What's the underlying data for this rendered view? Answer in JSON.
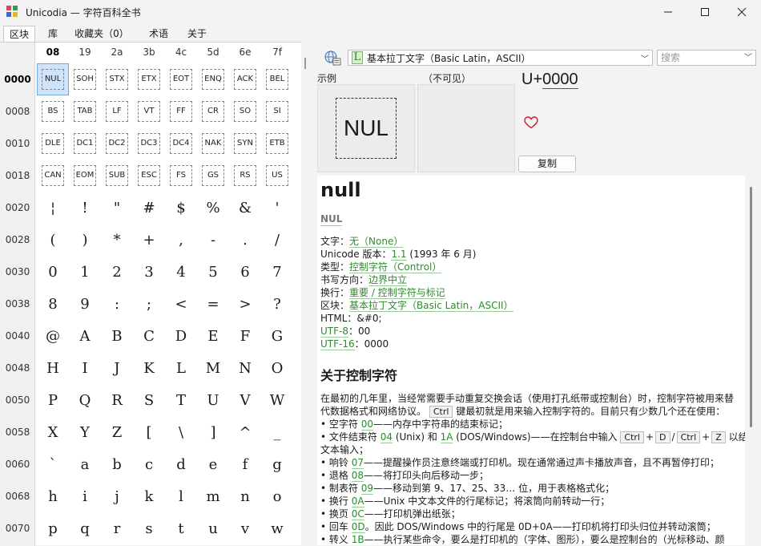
{
  "window": {
    "title": "Unicodia — 字符百科全书",
    "icon": "unicodia-app-icon",
    "controls": [
      "minimize-icon",
      "maximize-icon",
      "close-icon"
    ]
  },
  "tabs": [
    {
      "label": "区块",
      "active": true
    },
    {
      "label": "库",
      "active": false
    },
    {
      "label": "收藏夹（0）",
      "active": false
    },
    {
      "label": "术语",
      "active": false
    },
    {
      "label": "关于",
      "active": false
    }
  ],
  "grid": {
    "col_headers": [
      "08",
      "19",
      "2a",
      "3b",
      "4c",
      "5d",
      "6e",
      "7f"
    ],
    "selected_col": "08",
    "selected_row": "0000",
    "selected_cell": "NUL",
    "rows": [
      {
        "label": "0000",
        "cells": [
          "NUL",
          "SOH",
          "STX",
          "ETX",
          "EOT",
          "ENQ",
          "ACK",
          "BEL"
        ],
        "ctrl": true
      },
      {
        "label": "0008",
        "cells": [
          "BS",
          "TAB",
          "LF",
          "VT",
          "FF",
          "CR",
          "SO",
          "SI"
        ],
        "ctrl": true
      },
      {
        "label": "0010",
        "cells": [
          "DLE",
          "DC1",
          "DC2",
          "DC3",
          "DC4",
          "NAK",
          "SYN",
          "ETB"
        ],
        "ctrl": true
      },
      {
        "label": "0018",
        "cells": [
          "CAN",
          "EOM",
          "SUB",
          "ESC",
          "FS",
          "GS",
          "RS",
          "US"
        ],
        "ctrl": true
      },
      {
        "label": "0020",
        "cells": [
          "¦",
          "!",
          "\"",
          "#",
          "$",
          "%",
          "&",
          "'"
        ],
        "ctrl": false
      },
      {
        "label": "0028",
        "cells": [
          "(",
          ")",
          "*",
          "+",
          ",",
          "-",
          ".",
          "/"
        ],
        "ctrl": false
      },
      {
        "label": "0030",
        "cells": [
          "0",
          "1",
          "2",
          "3",
          "4",
          "5",
          "6",
          "7"
        ],
        "ctrl": false
      },
      {
        "label": "0038",
        "cells": [
          "8",
          "9",
          ":",
          ";",
          "<",
          "=",
          ">",
          "?"
        ],
        "ctrl": false
      },
      {
        "label": "0040",
        "cells": [
          "@",
          "A",
          "B",
          "C",
          "D",
          "E",
          "F",
          "G"
        ],
        "ctrl": false
      },
      {
        "label": "0048",
        "cells": [
          "H",
          "I",
          "J",
          "K",
          "L",
          "M",
          "N",
          "O"
        ],
        "ctrl": false
      },
      {
        "label": "0050",
        "cells": [
          "P",
          "Q",
          "R",
          "S",
          "T",
          "U",
          "V",
          "W"
        ],
        "ctrl": false
      },
      {
        "label": "0058",
        "cells": [
          "X",
          "Y",
          "Z",
          "[",
          "\\",
          "]",
          "^",
          "_"
        ],
        "ctrl": false
      },
      {
        "label": "0060",
        "cells": [
          "`",
          "a",
          "b",
          "c",
          "d",
          "e",
          "f",
          "g"
        ],
        "ctrl": false
      },
      {
        "label": "0068",
        "cells": [
          "h",
          "i",
          "j",
          "k",
          "l",
          "m",
          "n",
          "o"
        ],
        "ctrl": false
      },
      {
        "label": "0070",
        "cells": [
          "p",
          "q",
          "r",
          "s",
          "t",
          "u",
          "v",
          "w"
        ],
        "ctrl": false
      }
    ]
  },
  "toolbar": {
    "block_badge": "L",
    "block_name": "基本拉丁文字（Basic Latin，ASCII）",
    "search_placeholder": "搜索"
  },
  "preview": {
    "sample_label": "示例",
    "invisible_label": "（不可见）",
    "sample_text": "NUL",
    "code_prefix": "U+",
    "code_value": "0000",
    "favorite_icon": "heart-outline-icon",
    "copy_label": "复制"
  },
  "details": {
    "name": "null",
    "abbr": "NUL",
    "props": [
      {
        "k": "文字：",
        "v": "无（None）",
        "link": true
      },
      {
        "k": "Unicode 版本：",
        "v": "1.1",
        "link": true,
        "tail": " (1993 年 6 月)"
      },
      {
        "k": "类型：",
        "v": "控制字符（Control）",
        "link": true
      },
      {
        "k": "书写方向：",
        "v": "边界中立",
        "link": true
      },
      {
        "k": "换行：",
        "v": "重要 / 控制字符与标记",
        "link": true
      },
      {
        "k": "区块：",
        "v": "基本拉丁文字（Basic Latin，ASCII）",
        "link": true
      },
      {
        "k": "HTML：",
        "v": "&#0;",
        "link": false
      },
      {
        "k": "UTF-8",
        "v": "：00",
        "link": false,
        "klink": true
      },
      {
        "k": "UTF-16",
        "v": "：0000",
        "link": false,
        "klink": true
      }
    ],
    "section_title": "关于控制字符",
    "intro_1": "在最初的几年里，当经常需要手动重复交换会话（使用打孔纸带或控制台）时，控制字符被用来替代数据格式和网络协议。",
    "intro_kbd": "Ctrl",
    "intro_2": " 键最初就是用来输入控制字符的。目前只有少数几个还在使用：",
    "bullets": [
      {
        "pre": "• 空字符 ",
        "code": "00",
        "post": "——内存中字符串的结束标记；"
      },
      {
        "pre": "• 文件结束符 ",
        "code": "04",
        "mid": " (Unix) 和 ",
        "code2": "1A",
        "post": " (DOS/Windows)——在控制台中输入 "
      },
      {
        "pre": "文本输入；"
      },
      {
        "pre": "• 响铃 ",
        "code": "07",
        "post": "——提醒操作员注意终端或打印机。现在通常通过声卡播放声音，且不再暂停打印；"
      },
      {
        "pre": "• 退格 ",
        "code": "08",
        "post": "——将打印头向后移动一步；"
      },
      {
        "pre": "• 制表符 ",
        "code": "09",
        "post": "——移动到第 9、17、25、33… 位，用于表格格式化；"
      },
      {
        "pre": "• 换行 ",
        "code": "0A",
        "post": "——Unix 中文本文件的行尾标记；将滚筒向前转动一行；"
      },
      {
        "pre": "• 换页 ",
        "code": "0C",
        "post": "——打印机弹出纸张；"
      },
      {
        "pre": "• 回车 ",
        "code": "0D",
        "post": "。因此 DOS/Windows 中的行尾是 0D+0A——打印机将打印头归位并转动滚筒；"
      },
      {
        "pre": "• 转义 ",
        "code": "1B",
        "post": "——执行某些命令，要么是打印机的（字体、图形），要么是控制台的（光标移动、颜"
      }
    ],
    "eof_kbd": [
      "Ctrl",
      "+",
      "D",
      "/",
      "Ctrl",
      "+",
      "Z"
    ],
    "eof_tail": " 以结束"
  },
  "colors": {
    "link": "#2e8b2e",
    "selection": "#cfe4fa",
    "heart": "#c0203a"
  }
}
